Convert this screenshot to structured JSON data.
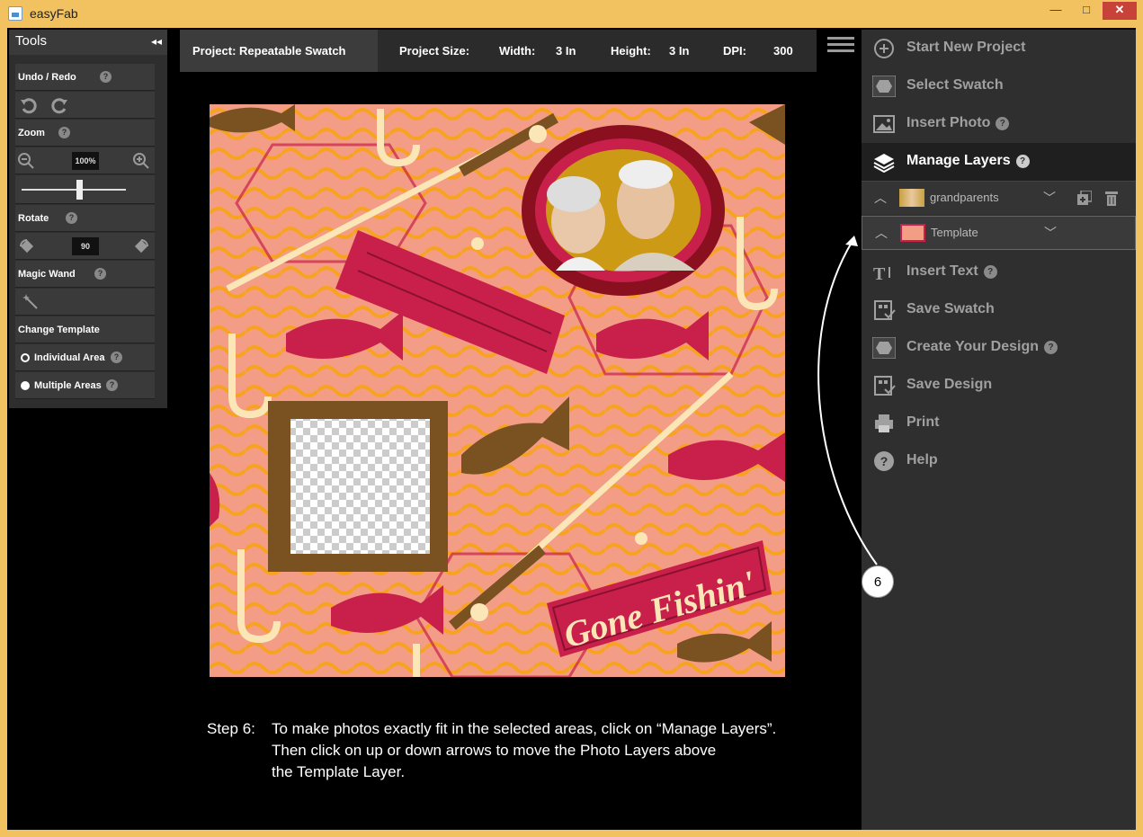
{
  "window": {
    "title": "easyFab",
    "controls": {
      "minimize": "—",
      "maximize": "□",
      "close": "✕"
    }
  },
  "tools": {
    "title": "Tools",
    "collapse_icon": "◂◂",
    "undo_redo": "Undo / Redo",
    "zoom": "Zoom",
    "zoom_value": "100%",
    "zoom_slider_level": 0.55,
    "rotate": "Rotate",
    "rotate_value": "90",
    "magic_wand": "Magic Wand",
    "change_template": "Change Template",
    "options": [
      {
        "label": "Individual Area",
        "selected": false
      },
      {
        "label": "Multiple Areas",
        "selected": true
      }
    ],
    "help": "?"
  },
  "infobar": {
    "project": "Project: Repeatable Swatch",
    "size_label": "Project Size:",
    "width_label": "Width:",
    "width_value": "3 In",
    "height_label": "Height:",
    "height_value": "3 In",
    "dpi_label": "DPI:",
    "dpi_value": "300"
  },
  "canvas": {
    "banner_text": "Gone Fishin'"
  },
  "step": {
    "label": "Step 6:",
    "line1": "To make photos exactly fit in the selected areas, click on “Manage Layers”.",
    "line2": "Then click on up or down arrows to move the Photo Layers above",
    "line3": "the Template Layer."
  },
  "menu": {
    "items": [
      {
        "label": "Start New Project",
        "icon": "plus-circle-icon"
      },
      {
        "label": "Select Swatch",
        "icon": "hexagon-icon"
      },
      {
        "label": "Insert Photo",
        "icon": "image-icon"
      },
      {
        "label": "Manage Layers",
        "icon": "layers-icon"
      },
      {
        "label": "Insert Text",
        "icon": "text-icon"
      },
      {
        "label": "Save Swatch",
        "icon": "save-icon"
      },
      {
        "label": "Create Your Design",
        "icon": "hexagon-icon"
      },
      {
        "label": "Save Design",
        "icon": "save-icon"
      },
      {
        "label": "Print",
        "icon": "printer-icon"
      },
      {
        "label": "Help",
        "icon": "help-icon"
      }
    ],
    "layers": [
      {
        "name": "grandparents"
      },
      {
        "name": "Template"
      }
    ]
  },
  "callout": {
    "number": "6"
  },
  "colors": {
    "canvas_bg": "#f39d86",
    "wave": "#f7a321",
    "crimson": "#c8204a",
    "brown": "#7a5222",
    "cream": "#fbe6b8",
    "window_frame": "#f2c260"
  }
}
